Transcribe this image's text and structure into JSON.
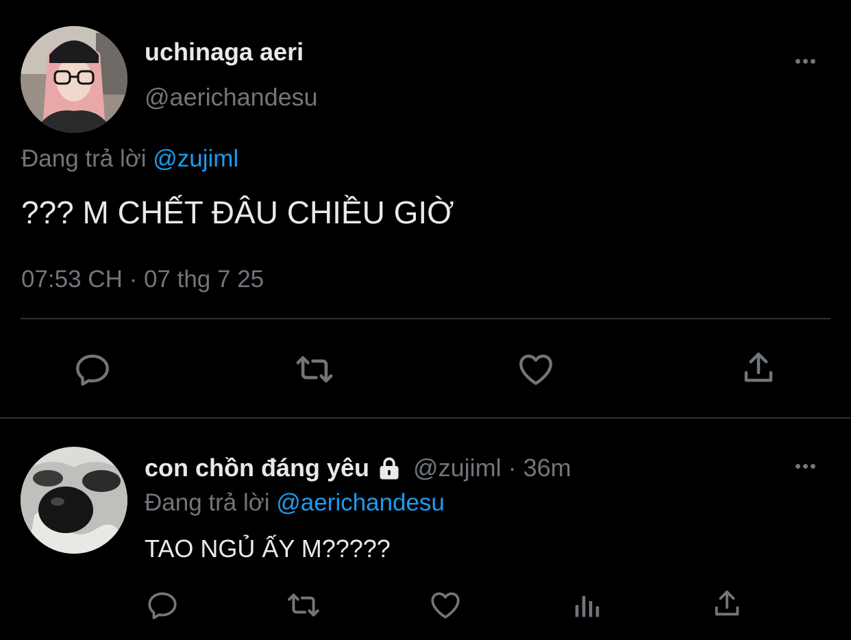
{
  "main_tweet": {
    "display_name": "uchinaga aeri",
    "handle": "@aerichandesu",
    "reply_prefix": "Đang trả lời",
    "reply_to": "@zujiml",
    "text": "??? M CHẾT ĐÂU CHIỀU GIỜ",
    "timestamp": "07:53 CH · 07 thg 7 25",
    "avatar_icon": "avatar-pink-hair-glasses",
    "actions": [
      "reply-icon",
      "retweet-icon",
      "like-icon",
      "share-icon"
    ]
  },
  "reply_tweet": {
    "display_name": "con chồn đáng yêu",
    "protected_icon": "lock-icon",
    "handle": "@zujiml",
    "separator": "·",
    "time_ago": "36m",
    "reply_prefix": "Đang trả lời",
    "reply_to": "@aerichandesu",
    "text": "TAO NGỦ ẤY M?????",
    "avatar_icon": "avatar-raccoon",
    "actions": [
      "reply-icon",
      "retweet-icon",
      "like-icon",
      "analytics-icon",
      "share-icon"
    ]
  },
  "colors": {
    "background": "#000000",
    "text": "#e7e9ea",
    "muted": "#71767b",
    "link": "#1d9bf0",
    "divider": "#2f3336"
  }
}
